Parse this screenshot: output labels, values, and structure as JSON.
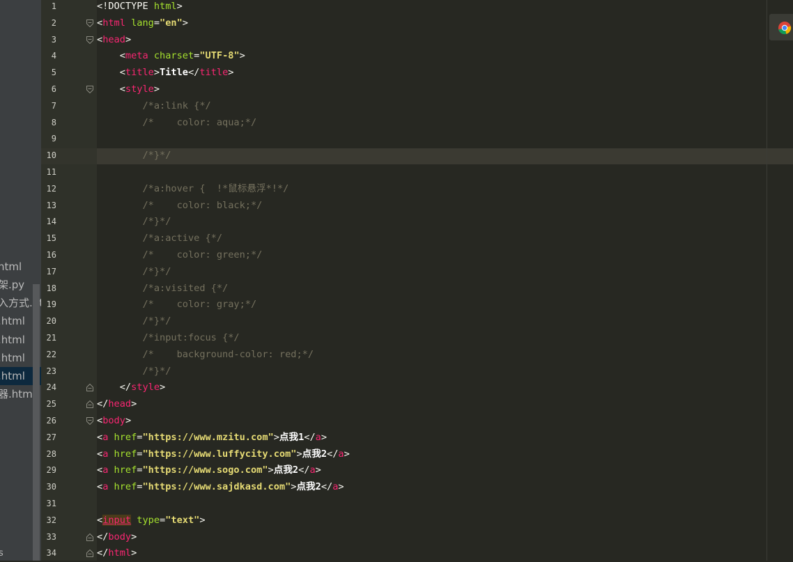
{
  "sidebar": {
    "files": [
      {
        "label": "html",
        "selected": false
      },
      {
        "label": "架.py",
        "selected": false
      },
      {
        "label": "入方式.html",
        "selected": false
      },
      {
        "label": ".html",
        "selected": false
      },
      {
        "label": ".html",
        "selected": false
      },
      {
        "label": ".html",
        "selected": false
      },
      {
        "label": ".html",
        "selected": true
      },
      {
        "label": "器.html",
        "selected": false
      }
    ],
    "bottom_text": "s"
  },
  "editor": {
    "current_line": 10,
    "lines": [
      {
        "n": "1",
        "tokens": [
          [
            "p",
            "<!DOCTYPE "
          ],
          [
            "at",
            "html"
          ],
          [
            "p",
            ">"
          ]
        ]
      },
      {
        "n": "2",
        "tokens": [
          [
            "p",
            "<"
          ],
          [
            "t",
            "html"
          ],
          [
            "at",
            " lang"
          ],
          [
            "p",
            "="
          ],
          [
            "s",
            "\"en\""
          ],
          [
            "p",
            ">"
          ]
        ]
      },
      {
        "n": "3",
        "tokens": [
          [
            "p",
            "<"
          ],
          [
            "t",
            "head"
          ],
          [
            "p",
            ">"
          ]
        ]
      },
      {
        "n": "4",
        "tokens": [
          [
            "p",
            "    <"
          ],
          [
            "t",
            "meta"
          ],
          [
            "at",
            " charset"
          ],
          [
            "p",
            "="
          ],
          [
            "s",
            "\"UTF-8\""
          ],
          [
            "p",
            ">"
          ]
        ]
      },
      {
        "n": "5",
        "tokens": [
          [
            "p",
            "    <"
          ],
          [
            "t",
            "title"
          ],
          [
            "p",
            ">"
          ],
          [
            "tx",
            "Title"
          ],
          [
            "p",
            "</"
          ],
          [
            "t",
            "title"
          ],
          [
            "p",
            ">"
          ]
        ]
      },
      {
        "n": "6",
        "tokens": [
          [
            "p",
            "    <"
          ],
          [
            "t",
            "style"
          ],
          [
            "p",
            ">"
          ]
        ]
      },
      {
        "n": "7",
        "tokens": [
          [
            "c",
            "        /*a:link {*/"
          ]
        ]
      },
      {
        "n": "8",
        "tokens": [
          [
            "c",
            "        /*    color: aqua;*/"
          ]
        ]
      },
      {
        "n": "9",
        "tokens": []
      },
      {
        "n": "10",
        "tokens": [
          [
            "c",
            "        /*}*/"
          ]
        ]
      },
      {
        "n": "11",
        "tokens": []
      },
      {
        "n": "12",
        "tokens": [
          [
            "c",
            "        /*a:hover {  !*鼠标悬浮*!*/"
          ]
        ]
      },
      {
        "n": "13",
        "tokens": [
          [
            "c",
            "        /*    color: black;*/"
          ]
        ]
      },
      {
        "n": "14",
        "tokens": [
          [
            "c",
            "        /*}*/"
          ]
        ]
      },
      {
        "n": "15",
        "tokens": [
          [
            "c",
            "        /*a:active {*/"
          ]
        ]
      },
      {
        "n": "16",
        "tokens": [
          [
            "c",
            "        /*    color: green;*/"
          ]
        ]
      },
      {
        "n": "17",
        "tokens": [
          [
            "c",
            "        /*}*/"
          ]
        ]
      },
      {
        "n": "18",
        "tokens": [
          [
            "c",
            "        /*a:visited {*/"
          ]
        ]
      },
      {
        "n": "19",
        "tokens": [
          [
            "c",
            "        /*    color: gray;*/"
          ]
        ]
      },
      {
        "n": "20",
        "tokens": [
          [
            "c",
            "        /*}*/"
          ]
        ]
      },
      {
        "n": "21",
        "tokens": [
          [
            "c",
            "        /*input:focus {*/"
          ]
        ]
      },
      {
        "n": "22",
        "tokens": [
          [
            "c",
            "        /*    background-color: red;*/"
          ]
        ]
      },
      {
        "n": "23",
        "tokens": [
          [
            "c",
            "        /*}*/"
          ]
        ]
      },
      {
        "n": "24",
        "tokens": [
          [
            "p",
            "    </"
          ],
          [
            "t",
            "style"
          ],
          [
            "p",
            ">"
          ]
        ]
      },
      {
        "n": "25",
        "tokens": [
          [
            "p",
            "</"
          ],
          [
            "t",
            "head"
          ],
          [
            "p",
            ">"
          ]
        ]
      },
      {
        "n": "26",
        "tokens": [
          [
            "p",
            "<"
          ],
          [
            "t",
            "body"
          ],
          [
            "p",
            ">"
          ]
        ]
      },
      {
        "n": "27",
        "tokens": [
          [
            "p",
            "<"
          ],
          [
            "t",
            "a"
          ],
          [
            "at",
            " href"
          ],
          [
            "p",
            "="
          ],
          [
            "s",
            "\"https://www.mzitu.com\""
          ],
          [
            "p",
            ">"
          ],
          [
            "tx",
            "点我1"
          ],
          [
            "p",
            "</"
          ],
          [
            "t",
            "a"
          ],
          [
            "p",
            ">"
          ]
        ]
      },
      {
        "n": "28",
        "tokens": [
          [
            "p",
            "<"
          ],
          [
            "t",
            "a"
          ],
          [
            "at",
            " href"
          ],
          [
            "p",
            "="
          ],
          [
            "s",
            "\"https://www.luffycity.com\""
          ],
          [
            "p",
            ">"
          ],
          [
            "tx",
            "点我2"
          ],
          [
            "p",
            "</"
          ],
          [
            "t",
            "a"
          ],
          [
            "p",
            ">"
          ]
        ]
      },
      {
        "n": "29",
        "tokens": [
          [
            "p",
            "<"
          ],
          [
            "t",
            "a"
          ],
          [
            "at",
            " href"
          ],
          [
            "p",
            "="
          ],
          [
            "s",
            "\"https://www.sogo.com\""
          ],
          [
            "p",
            ">"
          ],
          [
            "tx",
            "点我2"
          ],
          [
            "p",
            "</"
          ],
          [
            "t",
            "a"
          ],
          [
            "p",
            ">"
          ]
        ]
      },
      {
        "n": "30",
        "tokens": [
          [
            "p",
            "<"
          ],
          [
            "t",
            "a"
          ],
          [
            "at",
            " href"
          ],
          [
            "p",
            "="
          ],
          [
            "s",
            "\"https://www.sajdkasd.com\""
          ],
          [
            "p",
            ">"
          ],
          [
            "tx",
            "点我2"
          ],
          [
            "p",
            "</"
          ],
          [
            "t",
            "a"
          ],
          [
            "p",
            ">"
          ]
        ]
      },
      {
        "n": "31",
        "tokens": []
      },
      {
        "n": "32",
        "tokens": [
          [
            "p",
            "<"
          ],
          [
            "t flag",
            "input"
          ],
          [
            "at",
            " type"
          ],
          [
            "p",
            "="
          ],
          [
            "s",
            "\"text\""
          ],
          [
            "p",
            ">"
          ]
        ]
      },
      {
        "n": "33",
        "tokens": [
          [
            "p",
            "</"
          ],
          [
            "t",
            "body"
          ],
          [
            "p",
            ">"
          ]
        ]
      },
      {
        "n": "34",
        "tokens": [
          [
            "p",
            "</"
          ],
          [
            "t",
            "html"
          ],
          [
            "p",
            ">"
          ]
        ]
      }
    ],
    "fold_open_lines": [
      2,
      3,
      6,
      26
    ],
    "fold_close_lines": [
      24,
      25,
      33,
      34
    ]
  },
  "toolbar": {
    "browser_icon": "chrome-icon"
  },
  "colors": {
    "background": "#272822",
    "tag": "#f92672",
    "attribute": "#a6e22e",
    "string": "#e6db74",
    "comment": "#75715e",
    "current_line": "#3b3a32"
  }
}
